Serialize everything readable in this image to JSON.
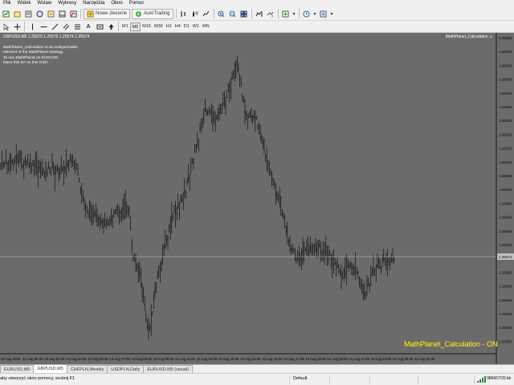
{
  "menu": [
    "Plik",
    "Widok",
    "Wstaw",
    "Wykresy",
    "Narzędzia",
    "Okno",
    "Pomoc"
  ],
  "toolbar": {
    "new_order_label": "Nowe zlecenie",
    "autotrading_label": "AutoTrading"
  },
  "timeframes": [
    "M1",
    "M5",
    "M15",
    "M30",
    "H1",
    "H4",
    "D1",
    "W1",
    "MN"
  ],
  "active_timeframe": "M5",
  "chart": {
    "symbol_line": "GBPUSD,M5  1.25575 1.25575 1.25574 1.25574",
    "ea_name": "MathPlanet_Calculation ☺",
    "ea_lines": [
      "MathPlanet_Calculation is an indispensable",
      "element of the MathPlanet strategy.",
      "To use MathPlanet on EURUSD,",
      "leave this EA on this chart."
    ],
    "status_text": "MathPlanet_Calculation - ON",
    "current_price": "1.25574",
    "price_labels": [
      "1.26685",
      "1.26625",
      "1.26565",
      "1.26505",
      "1.26445",
      "1.26385",
      "1.26325",
      "1.26265",
      "1.26205",
      "1.26145",
      "1.26085",
      "1.26025",
      "1.25965",
      "1.25905",
      "1.25845",
      "1.25785",
      "1.25725",
      "1.25665",
      "1.25605",
      "1.25545",
      "1.25485",
      "1.25425",
      "1.25365"
    ],
    "time_labels": [
      "12 Aug 2019",
      "13 Aug 00:45",
      "13 Aug 02:45",
      "13 Aug 04:25",
      "13 Aug 05:45",
      "13 Aug 07:05",
      "13 Aug 08:25",
      "13 Aug 09:45",
      "13 Aug 11:05",
      "13 Aug 12:25",
      "13 Aug 13:45",
      "13 Aug 15:05",
      "13 Aug 16:25",
      "13 Aug 17:45",
      "13 Aug 19:05",
      "13 Aug 20:25",
      "13 Aug 21:45",
      "13 Aug 23:05",
      "14 Aug 00:25",
      "14 Aug 01:45"
    ],
    "colors": {
      "background": "#6b6b6b",
      "bars": "#000000",
      "bid_line": "#c0c0c0",
      "status_text": "#ffff00"
    }
  },
  "tabs": [
    "EURUSD,M5",
    "GBPUSD,M5",
    "CHFPLN,Weekly",
    "USDPLN,Daily",
    "EURUSD,M5 (visual)"
  ],
  "active_tab": "GBPUSD,M5",
  "status": {
    "help": "aby otworzyć okno pomocy, wciśnij F1",
    "profile": "Default",
    "connection": "386667/20 kb"
  }
}
